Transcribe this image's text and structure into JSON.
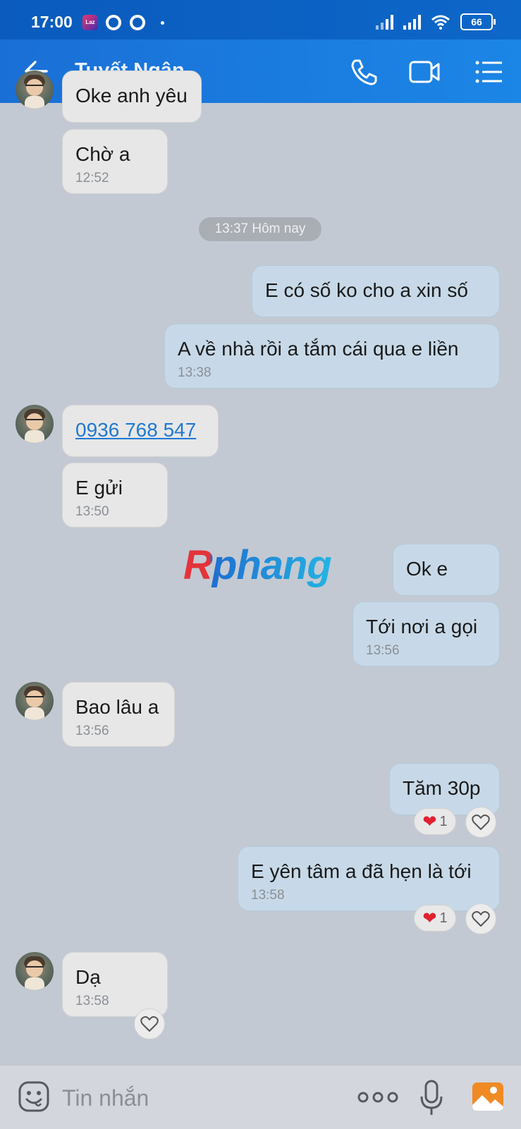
{
  "status_bar": {
    "time": "17:00",
    "laz_label": "Laz",
    "battery": "66"
  },
  "header": {
    "contact_name": "Tuyết Ngân"
  },
  "messages": [
    {
      "dir": "in",
      "text": "Oke anh yêu",
      "time": ""
    },
    {
      "dir": "in",
      "text": "Chờ a",
      "time": "12:52"
    },
    {
      "dir": "out",
      "text": "E có số ko cho a xin số",
      "time": ""
    },
    {
      "dir": "out",
      "text": "A về nhà rồi  a tắm cái qua e liền",
      "time": "13:38"
    },
    {
      "dir": "in",
      "text": "0936 768 547",
      "time": ""
    },
    {
      "dir": "in",
      "text": "E gửi",
      "time": "13:50"
    },
    {
      "dir": "out",
      "text": "Ok e",
      "time": ""
    },
    {
      "dir": "out",
      "text": "Tới nơi a gọi",
      "time": "13:56"
    },
    {
      "dir": "in",
      "text": "Bao lâu a",
      "time": "13:56"
    },
    {
      "dir": "out",
      "text": "Tăm 30p",
      "time": "",
      "reaction_count": "1"
    },
    {
      "dir": "out",
      "text": "E yên tâm a đã hẹn là tới",
      "time": "13:58",
      "reaction_count": "1"
    },
    {
      "dir": "in",
      "text": "Dạ",
      "time": "13:58"
    }
  ],
  "date_separator": "13:37 Hôm nay",
  "watermark": "Rphang",
  "composer": {
    "placeholder": "Tin nhắn"
  },
  "colors": {
    "header_blue": "#1b7ae0",
    "incoming_bubble": "#e7e7e7",
    "outgoing_bubble": "#c7d9e8",
    "chat_background": "#c3c9d2",
    "link": "#1f78d1",
    "heart": "#e0202f"
  },
  "icons": [
    "back-arrow-icon",
    "phone-icon",
    "video-camera-icon",
    "menu-list-icon",
    "sticker-icon",
    "more-dots-icon",
    "microphone-icon",
    "gallery-icon",
    "heart-icon"
  ]
}
